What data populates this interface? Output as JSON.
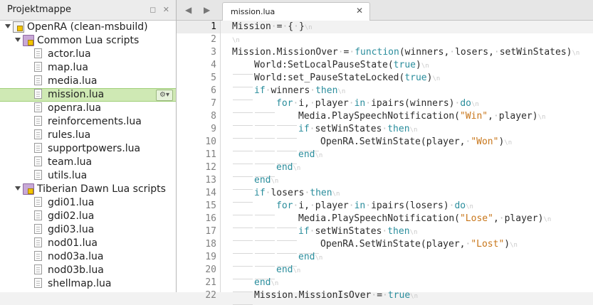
{
  "project_panel": {
    "title": "Projektmappe",
    "controls": "◻ ✕",
    "tree": [
      {
        "label": "OpenRA (clean-msbuild)",
        "type": "project",
        "level": 0,
        "expanded": true
      },
      {
        "label": "Common Lua scripts",
        "type": "folder",
        "level": 1,
        "expanded": true
      },
      {
        "label": "actor.lua",
        "type": "file",
        "level": 2
      },
      {
        "label": "map.lua",
        "type": "file",
        "level": 2
      },
      {
        "label": "media.lua",
        "type": "file",
        "level": 2
      },
      {
        "label": "mission.lua",
        "type": "file",
        "level": 2,
        "selected": true
      },
      {
        "label": "openra.lua",
        "type": "file",
        "level": 2
      },
      {
        "label": "reinforcements.lua",
        "type": "file",
        "level": 2
      },
      {
        "label": "rules.lua",
        "type": "file",
        "level": 2
      },
      {
        "label": "supportpowers.lua",
        "type": "file",
        "level": 2
      },
      {
        "label": "team.lua",
        "type": "file",
        "level": 2
      },
      {
        "label": "utils.lua",
        "type": "file",
        "level": 2
      },
      {
        "label": "Tiberian Dawn Lua scripts",
        "type": "folder",
        "level": 1,
        "expanded": true
      },
      {
        "label": "gdi01.lua",
        "type": "file",
        "level": 2
      },
      {
        "label": "gdi02.lua",
        "type": "file",
        "level": 2
      },
      {
        "label": "gdi03.lua",
        "type": "file",
        "level": 2
      },
      {
        "label": "nod01.lua",
        "type": "file",
        "level": 2
      },
      {
        "label": "nod03a.lua",
        "type": "file",
        "level": 2
      },
      {
        "label": "nod03b.lua",
        "type": "file",
        "level": 2
      },
      {
        "label": "shellmap.lua",
        "type": "file",
        "level": 2
      }
    ],
    "gear_icon_text": "⚙▾"
  },
  "editor": {
    "nav_back": "◀",
    "nav_forward": "▶",
    "tab_label": "mission.lua",
    "tab_close": "✕",
    "current_line": 1,
    "eol_marker": "\\n",
    "lines": [
      {
        "n": "1",
        "indent": 0,
        "tokens": [
          [
            "t",
            "Mission"
          ],
          [
            "sp",
            ""
          ],
          [
            "t",
            "="
          ],
          [
            "sp",
            ""
          ],
          [
            "t",
            "{"
          ],
          [
            "sp",
            ""
          ],
          [
            "t",
            "}"
          ]
        ]
      },
      {
        "n": "2",
        "indent": 0,
        "tokens": []
      },
      {
        "n": "3",
        "indent": 0,
        "tokens": [
          [
            "t",
            "Mission.MissionOver"
          ],
          [
            "sp",
            ""
          ],
          [
            "t",
            "="
          ],
          [
            "sp",
            ""
          ],
          [
            "k",
            "function"
          ],
          [
            "t",
            "(winners,"
          ],
          [
            "sp",
            ""
          ],
          [
            "t",
            "losers,"
          ],
          [
            "sp",
            ""
          ],
          [
            "t",
            "setWinStates)"
          ]
        ]
      },
      {
        "n": "4",
        "indent": 1,
        "tokens": [
          [
            "t",
            "World:SetLocalPauseState("
          ],
          [
            "k",
            "true"
          ],
          [
            "t",
            ")"
          ]
        ]
      },
      {
        "n": "5",
        "indent": 1,
        "tokens": [
          [
            "t",
            "World:set_PauseStateLocked("
          ],
          [
            "k",
            "true"
          ],
          [
            "t",
            ")"
          ]
        ]
      },
      {
        "n": "6",
        "indent": 1,
        "tokens": [
          [
            "k",
            "if"
          ],
          [
            "sp",
            ""
          ],
          [
            "t",
            "winners"
          ],
          [
            "sp",
            ""
          ],
          [
            "k",
            "then"
          ]
        ]
      },
      {
        "n": "7",
        "indent": 2,
        "tokens": [
          [
            "k",
            "for"
          ],
          [
            "sp",
            ""
          ],
          [
            "t",
            "i,"
          ],
          [
            "sp",
            ""
          ],
          [
            "t",
            "player"
          ],
          [
            "sp",
            ""
          ],
          [
            "k",
            "in"
          ],
          [
            "sp",
            ""
          ],
          [
            "t",
            "ipairs(winners)"
          ],
          [
            "sp",
            ""
          ],
          [
            "k",
            "do"
          ]
        ]
      },
      {
        "n": "8",
        "indent": 3,
        "tokens": [
          [
            "t",
            "Media.PlaySpeechNotification("
          ],
          [
            "s",
            "\"Win\""
          ],
          [
            "t",
            ","
          ],
          [
            "sp",
            ""
          ],
          [
            "t",
            "player)"
          ]
        ]
      },
      {
        "n": "9",
        "indent": 3,
        "tokens": [
          [
            "k",
            "if"
          ],
          [
            "sp",
            ""
          ],
          [
            "t",
            "setWinStates"
          ],
          [
            "sp",
            ""
          ],
          [
            "k",
            "then"
          ]
        ]
      },
      {
        "n": "10",
        "indent": 4,
        "tokens": [
          [
            "t",
            "OpenRA.SetWinState(player,"
          ],
          [
            "sp",
            ""
          ],
          [
            "s",
            "\"Won\""
          ],
          [
            "t",
            ")"
          ]
        ]
      },
      {
        "n": "11",
        "indent": 3,
        "tokens": [
          [
            "k",
            "end"
          ]
        ]
      },
      {
        "n": "12",
        "indent": 2,
        "tokens": [
          [
            "k",
            "end"
          ]
        ]
      },
      {
        "n": "13",
        "indent": 1,
        "tokens": [
          [
            "k",
            "end"
          ]
        ]
      },
      {
        "n": "14",
        "indent": 1,
        "tokens": [
          [
            "k",
            "if"
          ],
          [
            "sp",
            ""
          ],
          [
            "t",
            "losers"
          ],
          [
            "sp",
            ""
          ],
          [
            "k",
            "then"
          ]
        ]
      },
      {
        "n": "15",
        "indent": 2,
        "tokens": [
          [
            "k",
            "for"
          ],
          [
            "sp",
            ""
          ],
          [
            "t",
            "i,"
          ],
          [
            "sp",
            ""
          ],
          [
            "t",
            "player"
          ],
          [
            "sp",
            ""
          ],
          [
            "k",
            "in"
          ],
          [
            "sp",
            ""
          ],
          [
            "t",
            "ipairs(losers)"
          ],
          [
            "sp",
            ""
          ],
          [
            "k",
            "do"
          ]
        ]
      },
      {
        "n": "16",
        "indent": 3,
        "tokens": [
          [
            "t",
            "Media.PlaySpeechNotification("
          ],
          [
            "s",
            "\"Lose\""
          ],
          [
            "t",
            ","
          ],
          [
            "sp",
            ""
          ],
          [
            "t",
            "player)"
          ]
        ]
      },
      {
        "n": "17",
        "indent": 3,
        "tokens": [
          [
            "k",
            "if"
          ],
          [
            "sp",
            ""
          ],
          [
            "t",
            "setWinStates"
          ],
          [
            "sp",
            ""
          ],
          [
            "k",
            "then"
          ]
        ]
      },
      {
        "n": "18",
        "indent": 4,
        "tokens": [
          [
            "t",
            "OpenRA.SetWinState(player,"
          ],
          [
            "sp",
            ""
          ],
          [
            "s",
            "\"Lost\""
          ],
          [
            "t",
            ")"
          ]
        ]
      },
      {
        "n": "19",
        "indent": 3,
        "tokens": [
          [
            "k",
            "end"
          ]
        ]
      },
      {
        "n": "20",
        "indent": 2,
        "tokens": [
          [
            "k",
            "end"
          ]
        ]
      },
      {
        "n": "21",
        "indent": 1,
        "tokens": [
          [
            "k",
            "end"
          ]
        ]
      },
      {
        "n": "22",
        "indent": 1,
        "tokens": [
          [
            "t",
            "Mission.MissionIsOver"
          ],
          [
            "sp",
            ""
          ],
          [
            "t",
            "="
          ],
          [
            "sp",
            ""
          ],
          [
            "k",
            "true"
          ]
        ]
      }
    ]
  }
}
